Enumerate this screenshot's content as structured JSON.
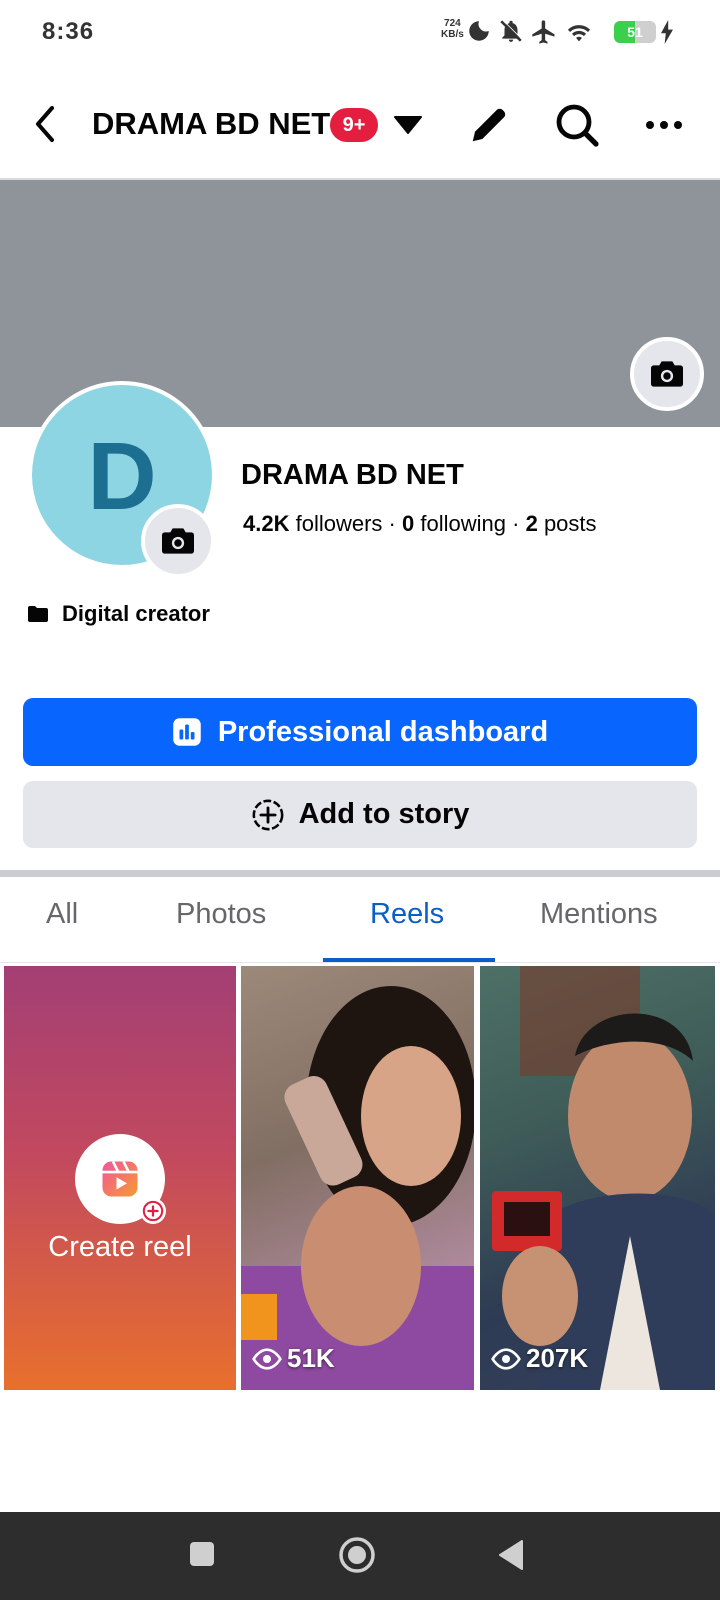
{
  "status_bar": {
    "time": "8:36",
    "net_speed": "724",
    "net_unit": "KB/s",
    "battery": "51",
    "battery_level": 0.51
  },
  "header": {
    "title": "DRAMA BD NET",
    "badge": "9+"
  },
  "profile": {
    "avatar_letter": "D",
    "name": "DRAMA BD NET",
    "followers": "4.2K",
    "followers_label": "followers",
    "following": "0",
    "following_label": "following",
    "posts": "2",
    "posts_label": "posts",
    "separator": "·",
    "category": "Digital creator"
  },
  "buttons": {
    "dashboard": "Professional dashboard",
    "story": "Add to story"
  },
  "tabs": [
    {
      "label": "All"
    },
    {
      "label": "Photos"
    },
    {
      "label": "Reels",
      "active": true
    },
    {
      "label": "Mentions"
    }
  ],
  "reels": {
    "create_label": "Create reel",
    "items": [
      {
        "views": "51K"
      },
      {
        "views": "207K"
      }
    ]
  },
  "colors": {
    "accent": "#0866ff",
    "badge": "#e41e3f",
    "tab_active": "#0a5ec6",
    "cover": "#8f949b",
    "avatar_bg": "#8dd5e2"
  },
  "icons": [
    "back-arrow-icon",
    "dropdown-caret-icon",
    "edit-pencil-icon",
    "search-icon",
    "more-icon",
    "camera-icon",
    "briefcase-icon",
    "dashboard-chart-icon",
    "add-circle-icon",
    "reels-icon",
    "eye-icon",
    "nav-square-icon",
    "nav-home-icon",
    "nav-back-icon"
  ]
}
